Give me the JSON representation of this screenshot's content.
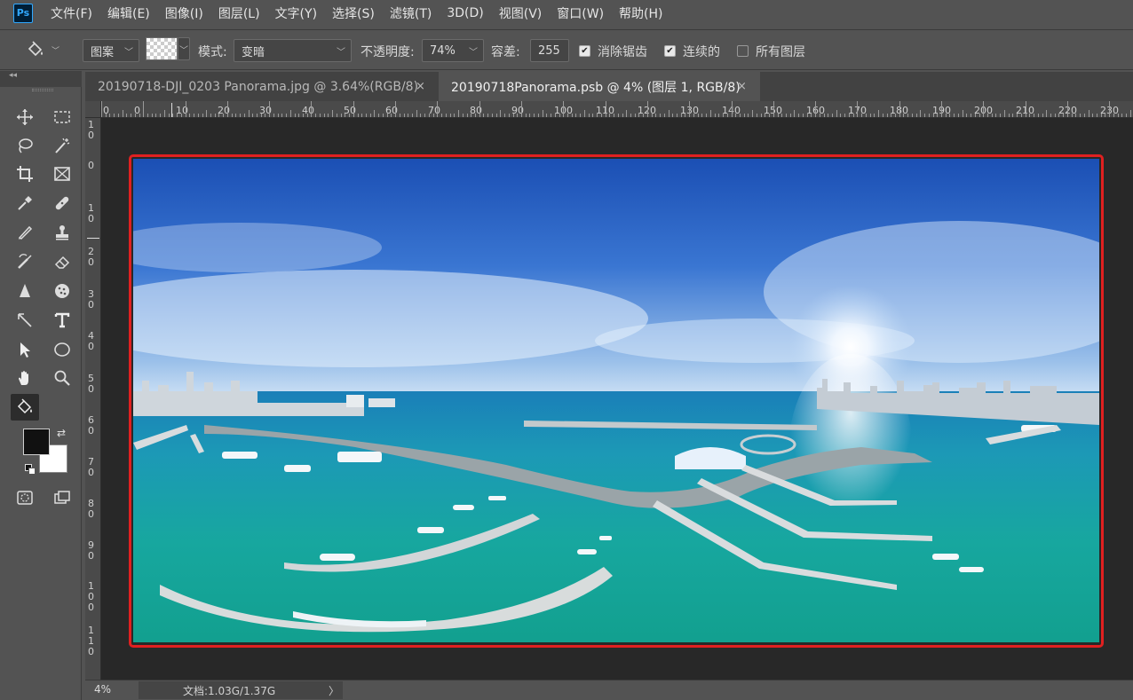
{
  "app": {
    "logo": "Ps"
  },
  "menu": [
    {
      "label": "文件(F)"
    },
    {
      "label": "编辑(E)"
    },
    {
      "label": "图像(I)"
    },
    {
      "label": "图层(L)"
    },
    {
      "label": "文字(Y)"
    },
    {
      "label": "选择(S)"
    },
    {
      "label": "滤镜(T)"
    },
    {
      "label": "3D(D)"
    },
    {
      "label": "视图(V)"
    },
    {
      "label": "窗口(W)"
    },
    {
      "label": "帮助(H)"
    }
  ],
  "options": {
    "fill_source": "图案",
    "mode_label": "模式:",
    "mode_value": "变暗",
    "opacity_label": "不透明度:",
    "opacity_value": "74%",
    "tolerance_label": "容差:",
    "tolerance_value": "255",
    "antialias_label": "消除锯齿",
    "antialias_checked": true,
    "contiguous_label": "连续的",
    "contiguous_checked": true,
    "all_layers_label": "所有图层",
    "all_layers_checked": false
  },
  "tabs": [
    {
      "label": "20190718-DJI_0203 Panorama.jpg @ 3.64%(RGB/8)",
      "close": "×",
      "active": false
    },
    {
      "label": "20190718Panorama.psb  @ 4% (图层 1, RGB/8)",
      "close": "×",
      "active": true
    }
  ],
  "ruler_top": [
    "0",
    "0",
    "10",
    "20",
    "30",
    "40",
    "50",
    "60",
    "70",
    "80",
    "90",
    "100",
    "110",
    "120",
    "130",
    "140",
    "150",
    "160",
    "170",
    "180",
    "190",
    "200",
    "210",
    "220",
    "230"
  ],
  "ruler_left": [
    "1 0",
    "0",
    "1 0",
    "2 0",
    "3 0",
    "4 0",
    "5 0",
    "6 0",
    "7 0",
    "8 0",
    "9 0",
    "1 0 0",
    "1 1 0"
  ],
  "colors": {
    "foreground": "#111111",
    "background": "#ffffff",
    "highlight": "#e02020"
  },
  "status": {
    "zoom": "4%",
    "doc_info": "文档:1.03G/1.37G",
    "arrow": "〉"
  },
  "tools": [
    {
      "name": "move-tool-icon"
    },
    {
      "name": "marquee-tool-icon"
    },
    {
      "name": "lasso-tool-icon"
    },
    {
      "name": "magic-wand-tool-icon"
    },
    {
      "name": "crop-tool-icon"
    },
    {
      "name": "frame-tool-icon"
    },
    {
      "name": "eyedropper-tool-icon"
    },
    {
      "name": "healing-brush-tool-icon"
    },
    {
      "name": "brush-tool-icon"
    },
    {
      "name": "clone-stamp-tool-icon"
    },
    {
      "name": "history-brush-tool-icon"
    },
    {
      "name": "eraser-tool-icon"
    },
    {
      "name": "blur-tool-icon"
    },
    {
      "name": "sponge-tool-icon"
    },
    {
      "name": "pen-tool-icon"
    },
    {
      "name": "type-tool-icon"
    },
    {
      "name": "path-selection-tool-icon"
    },
    {
      "name": "ellipse-tool-icon"
    },
    {
      "name": "hand-tool-icon"
    },
    {
      "name": "zoom-tool-icon"
    },
    {
      "name": "paint-bucket-tool-icon",
      "active": true
    }
  ]
}
